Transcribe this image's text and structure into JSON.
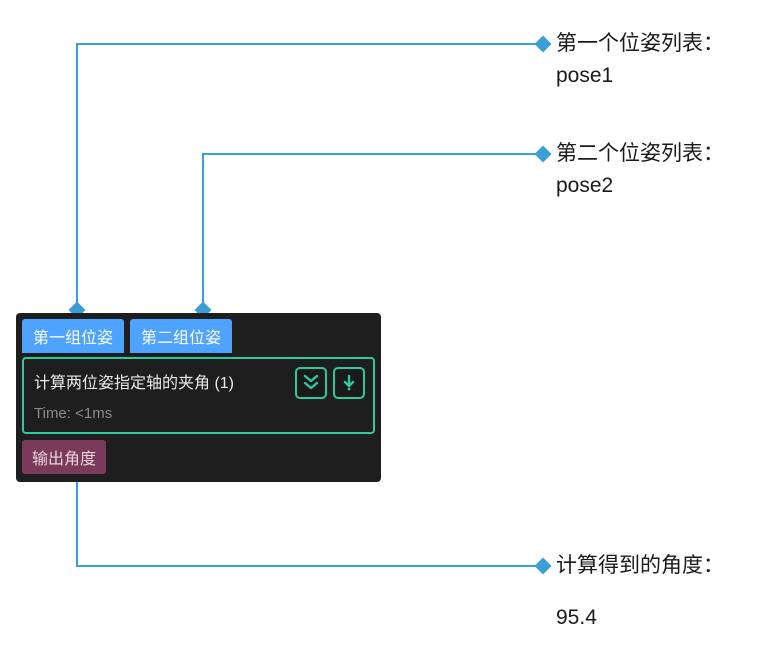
{
  "annotations": {
    "input1": {
      "label": "第一个位姿列表：",
      "value": "pose1"
    },
    "input2": {
      "label": "第二个位姿列表：",
      "value": "pose2"
    },
    "output": {
      "label": "计算得到的角度：",
      "value": "95.4"
    }
  },
  "node": {
    "tabs": [
      "第一组位姿",
      "第二组位姿"
    ],
    "title": "计算两位姿指定轴的夹角 (1)",
    "time": "Time: <1ms",
    "output_tag": "输出角度"
  },
  "colors": {
    "connector": "#3a9fd8",
    "node_bg": "#1e1e1e",
    "tab_bg": "#4da3ff",
    "border_green": "#2fc9a0",
    "output_bg": "#7a3b5a"
  }
}
